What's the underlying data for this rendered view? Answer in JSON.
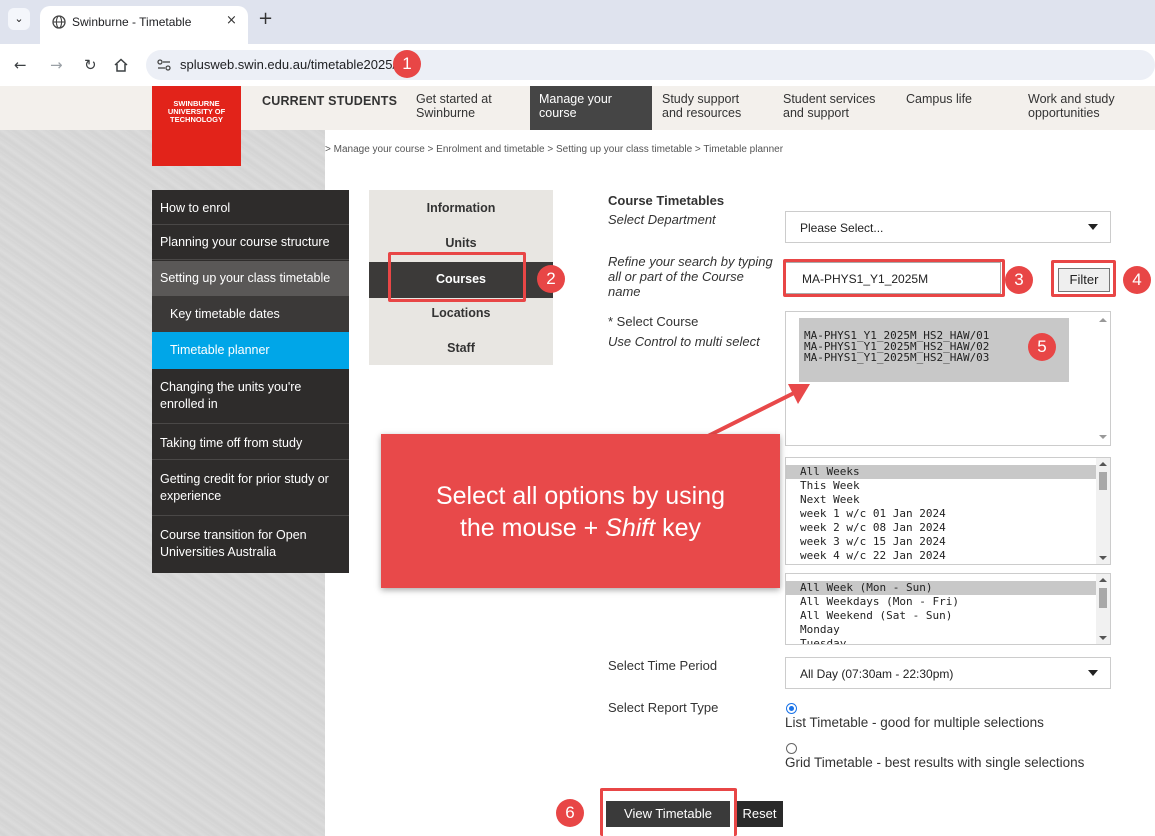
{
  "browser": {
    "tab_title": "Swinburne - Timetable",
    "tab_close": "×",
    "new_tab": "+",
    "url": "splusweb.swin.edu.au/timetable2025/"
  },
  "header": {
    "logo_lines": [
      "SWINBURNE",
      "UNIVERSITY OF",
      "TECHNOLOGY"
    ],
    "current_students": "CURRENT STUDENTS",
    "nav": [
      {
        "line1": "Get started at",
        "line2": "Swinburne"
      },
      {
        "line1": "Manage your",
        "line2": "course"
      },
      {
        "line1": "Study support",
        "line2": "and resources"
      },
      {
        "line1": "Student services",
        "line2": "and support"
      },
      {
        "line1": "Campus life",
        "line2": ""
      },
      {
        "line1": "Work and study",
        "line2": "opportunities"
      }
    ]
  },
  "breadcrumb": "> Manage your course > Enrolment and timetable > Setting up your class timetable > Timetable planner",
  "sidebar": {
    "items": [
      {
        "line1": "How to enrol",
        "line2": ""
      },
      {
        "line1": "Planning your course structure",
        "line2": ""
      },
      {
        "line1": "Setting up your class timetable",
        "line2": ""
      },
      {
        "line1": "Key timetable dates",
        "line2": ""
      },
      {
        "line1": "Timetable planner",
        "line2": ""
      },
      {
        "line1": "Changing the units you're",
        "line2": "enrolled in"
      },
      {
        "line1": "Taking time off from study",
        "line2": ""
      },
      {
        "line1": "Getting credit for prior study or",
        "line2": "experience"
      },
      {
        "line1": "Course transition for Open",
        "line2": "Universities Australia"
      }
    ]
  },
  "subnav": {
    "items": [
      "Information",
      "Units",
      "Courses",
      "Locations",
      "Staff"
    ]
  },
  "form": {
    "heading": "Course Timetables",
    "select_department_label": "Select Department",
    "department_value": "Please Select...",
    "refine_label_lines": [
      "Refine your search by typing",
      "all or part of the Course",
      "name"
    ],
    "search_value": "MA-PHYS1_Y1_2025M",
    "filter_label": "Filter",
    "select_course_label": "* Select Course",
    "multi_select_hint": "Use Control to multi select",
    "courses": [
      "MA-PHYS1_Y1_2025M_HS2_HAW/01",
      "MA-PHYS1_Y1_2025M_HS2_HAW/02",
      "MA-PHYS1_Y1_2025M_HS2_HAW/03"
    ],
    "weeks": [
      "All Weeks",
      "This Week",
      "Next Week",
      "week 1 w/c 01 Jan 2024",
      "week 2 w/c 08 Jan 2024",
      "week 3 w/c 15 Jan 2024",
      "week 4 w/c 22 Jan 2024"
    ],
    "days": [
      "All Week (Mon - Sun)",
      "All Weekdays (Mon - Fri)",
      "All Weekend (Sat - Sun)",
      "Monday",
      "Tuesday"
    ],
    "time_period_label": "Select Time Period",
    "time_period_value": "All Day (07:30am - 22:30pm)",
    "report_type_label": "Select Report Type",
    "report_list": "List Timetable - good for multiple selections",
    "report_grid": "Grid Timetable - best results with single selections",
    "view_button": "View Timetable",
    "reset_button": "Reset"
  },
  "annotations": {
    "badges": [
      "1",
      "2",
      "3",
      "4",
      "5",
      "6"
    ],
    "callout_line1": "Select all options by using",
    "callout_line2_pre": "the mouse + ",
    "callout_line2_em": "Shift",
    "callout_line2_post": " key"
  },
  "colors": {
    "brand_red": "#e2231a",
    "annotation_red": "#e84646",
    "sidebar_active": "#00a6e8",
    "dark": "#2e2c2b"
  }
}
